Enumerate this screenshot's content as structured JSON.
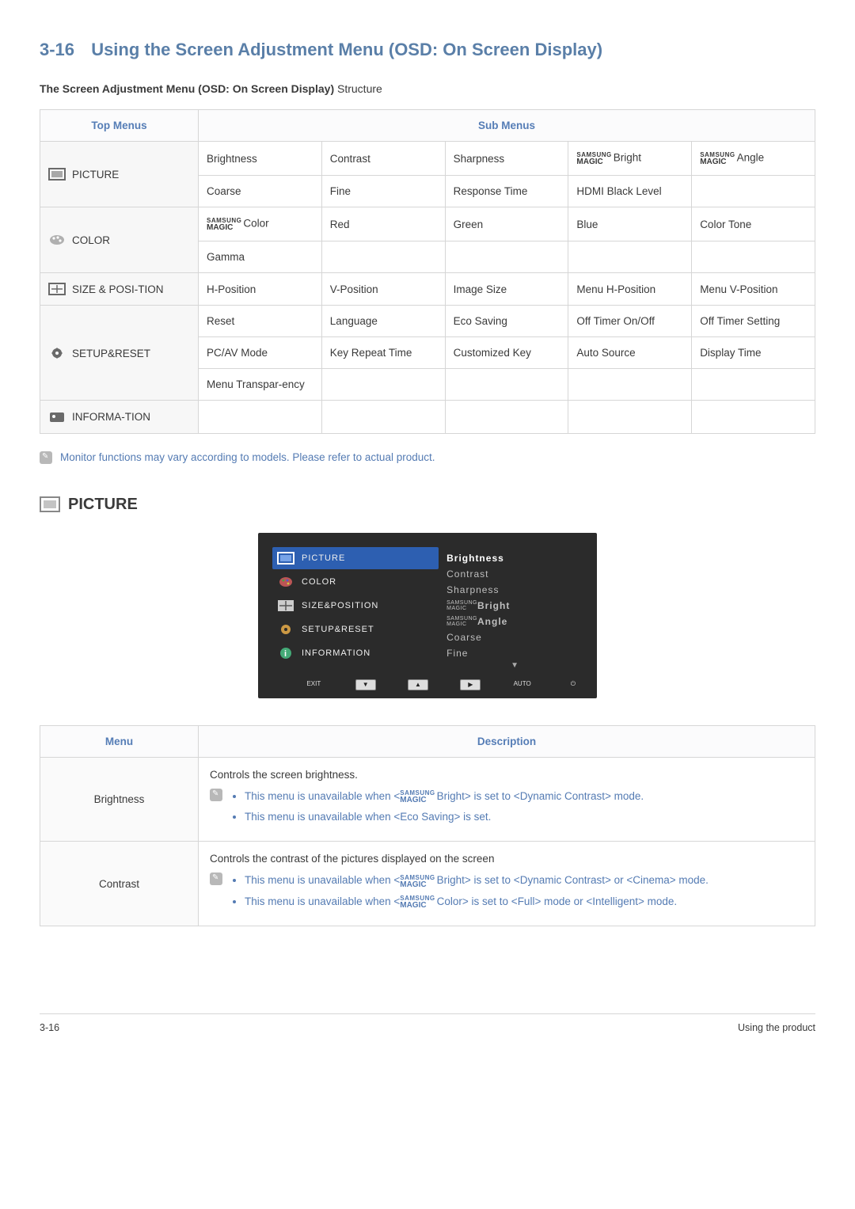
{
  "header": {
    "number": "3-16",
    "title": "Using the Screen Adjustment Menu (OSD: On Screen Display)"
  },
  "subheading_bold": "The Screen Adjustment Menu (OSD: On Screen Display)",
  "subheading_rest": " Structure",
  "table_head": {
    "top": "Top Menus",
    "sub": "Sub Menus"
  },
  "top_menus": {
    "picture": "PICTURE",
    "color": "COLOR",
    "sizepos": "SIZE & POSI-TION",
    "setup": "SETUP&RESET",
    "info": "INFORMA-TION"
  },
  "sub": {
    "picture_r1": [
      "Brightness",
      "Contrast",
      "Sharpness",
      "Bright",
      "Angle"
    ],
    "picture_r2": [
      "Coarse",
      "Fine",
      "Response Time",
      "HDMI Black Level",
      ""
    ],
    "color_r1": [
      "Color",
      "Red",
      "Green",
      "Blue",
      "Color Tone"
    ],
    "color_r2": [
      "Gamma",
      "",
      "",
      "",
      ""
    ],
    "sizepos_r1": [
      "H-Position",
      "V-Position",
      "Image Size",
      "Menu H-Position",
      "Menu V-Position"
    ],
    "setup_r1": [
      "Reset",
      "Language",
      "Eco Saving",
      "Off Timer On/Off",
      "Off Timer Setting"
    ],
    "setup_r2": [
      "PC/AV Mode",
      "Key Repeat Time",
      "Customized Key",
      "Auto Source",
      "Display Time"
    ],
    "setup_r3": [
      "Menu Transpar-ency",
      "",
      "",
      "",
      ""
    ],
    "info_r1": [
      "",
      "",
      "",
      "",
      ""
    ]
  },
  "magic": {
    "samsung": "SAMSUNG",
    "magic": "MAGIC"
  },
  "note_text": "Monitor functions may vary according to models. Please refer to actual product.",
  "picture_section_label": "PICTURE",
  "osd": {
    "left": [
      "PICTURE",
      "COLOR",
      "SIZE&POSITION",
      "SETUP&RESET",
      "INFORMATION"
    ],
    "right_sel": "Brightness",
    "right": [
      "Contrast",
      "Sharpness",
      "Bright",
      "Angle",
      "Coarse",
      "Fine"
    ],
    "bottom": [
      "EXIT",
      "AUTO"
    ]
  },
  "desc_head": {
    "menu": "Menu",
    "description": "Description"
  },
  "desc_rows": {
    "brightness": {
      "label": "Brightness",
      "lead": "Controls the screen brightness.",
      "li1a": "This menu is unavailable when <",
      "li1b": "Bright> is set to <Dynamic Contrast> mode.",
      "li2": "This menu is unavailable when <Eco Saving> is set."
    },
    "contrast": {
      "label": "Contrast",
      "lead": "Controls the contrast of the pictures displayed on the screen",
      "li1a": "This menu is unavailable when <",
      "li1b": "Bright> is set to <Dynamic Contrast> or <Cinema> mode.",
      "li2a": "This menu is unavailable when <",
      "li2b": "Color> is set to <Full> mode or <Intelligent> mode."
    }
  },
  "footer": {
    "left": "3-16",
    "right": "Using the product"
  }
}
